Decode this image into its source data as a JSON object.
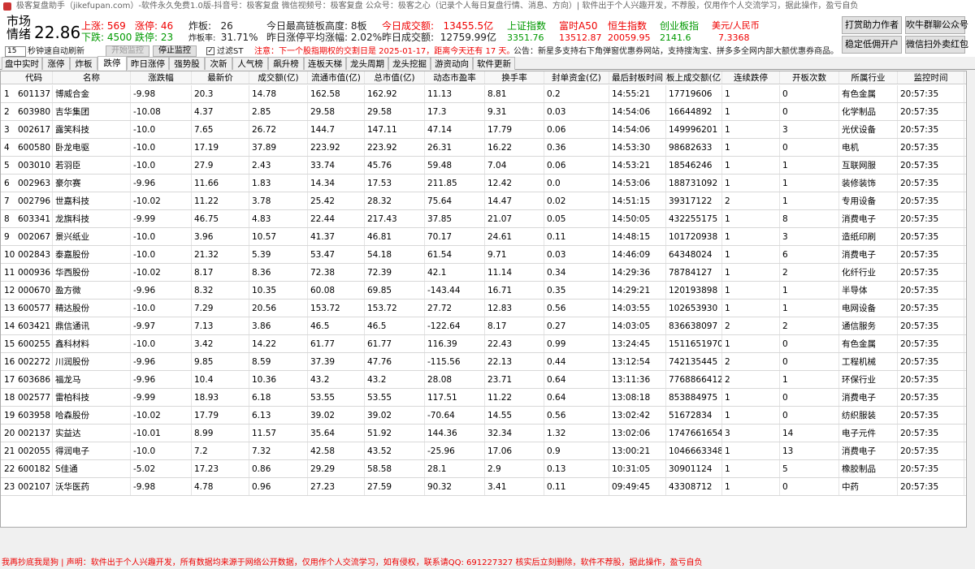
{
  "window": {
    "title": "极客复盘助手（jikefupan.com）-软件永久免费1.0版-抖音号：极客复盘  微信视频号：极客复盘  公众号：极客之心（记录个人每日复盘行情、消息、方向）| 软件出于个人兴趣开发，不荐股，仅用作个人交流学习，据此操作，盈亏自负"
  },
  "header": {
    "market_label": "市场\n情绪",
    "market_value": "22.86",
    "up_label": "上涨:",
    "up_value": "569",
    "limitup_label": "涨停:",
    "limitup_value": "46",
    "down_label": "下跌:",
    "down_value": "4500",
    "limitdown_label": "跌停:",
    "limitdown_value": "23",
    "zhaban_label": "炸板:",
    "zhaban_value": "26",
    "zhaban_rate_label": "炸板率:",
    "zhaban_rate_value": "31.71%",
    "max_height": "今日最高链板高度: 8板",
    "yest_avg": "昨日涨停平均涨幅: 2.02%",
    "today_vol_label": "今日成交额:",
    "today_vol_value": "13455.5亿",
    "yest_vol_label": "昨日成交额:",
    "yest_vol_value": "12759.99亿",
    "indices": [
      {
        "name": "上证指数",
        "value": "3351.76"
      },
      {
        "name": "富时A50",
        "value": "13512.87"
      },
      {
        "name": "恒生指数",
        "value": "20059.95"
      },
      {
        "name": "创业板指",
        "value": "2141.6"
      },
      {
        "name": "美元/人民币",
        "value": "7.3368"
      }
    ],
    "buttons": {
      "reward": "打赏助力作者",
      "cattle": "吹牛群聊公众号",
      "account": "稳定低佣开户",
      "wechat": "微信扫外卖红包"
    }
  },
  "toolbar": {
    "interval_value": "15",
    "interval_label": "秒钟速自动刷新",
    "start_btn": "开始监控",
    "stop_btn": "停止监控",
    "filter_st": "过滤ST",
    "notice": "注意：下一个股指期权的交割日是 2025-01-17，距离今天还有 17 天。",
    "announce": "公告：新星多支持右下角弹窗优惠券网站，支持搜淘宝、拼多多全网内部大额优惠券商品。"
  },
  "tabs": [
    "盘中实时",
    "涨停",
    "炸板",
    "跌停",
    "昨日涨停",
    "强势股",
    "次新",
    "人气榜",
    "飙升榜",
    "连板天梯",
    "龙头周期",
    "龙头挖掘",
    "游资动向",
    "软件更新"
  ],
  "active_tab": "跌停",
  "columns": [
    "代码",
    "名称",
    "涨跌幅",
    "最新价",
    "成交额(亿)",
    "流通市值(亿)",
    "总市值(亿)",
    "动态市盈率",
    "换手率",
    "封单资金(亿)",
    "最后封板时间",
    "板上成交额(亿)",
    "连续跌停",
    "开板次数",
    "所属行业",
    "监控时间"
  ],
  "rows": [
    [
      "601137",
      "博威合金",
      "-9.98",
      "20.3",
      "14.78",
      "162.58",
      "162.92",
      "11.13",
      "8.81",
      "0.2",
      "14:55:21",
      "17719606",
      "1",
      "0",
      "有色金属",
      "20:57:35"
    ],
    [
      "603980",
      "吉华集团",
      "-10.08",
      "4.37",
      "2.85",
      "29.58",
      "29.58",
      "17.3",
      "9.31",
      "0.03",
      "14:54:06",
      "16644892",
      "1",
      "0",
      "化学制品",
      "20:57:35"
    ],
    [
      "002617",
      "露笑科技",
      "-10.0",
      "7.65",
      "26.72",
      "144.7",
      "147.11",
      "47.14",
      "17.79",
      "0.06",
      "14:54:06",
      "149996201",
      "1",
      "3",
      "光伏设备",
      "20:57:35"
    ],
    [
      "600580",
      "卧龙电驱",
      "-10.0",
      "17.19",
      "37.89",
      "223.92",
      "223.92",
      "26.31",
      "16.22",
      "0.36",
      "14:53:30",
      "98682633",
      "1",
      "0",
      "电机",
      "20:57:35"
    ],
    [
      "003010",
      "若羽臣",
      "-10.0",
      "27.9",
      "2.43",
      "33.74",
      "45.76",
      "59.48",
      "7.04",
      "0.06",
      "14:53:21",
      "18546246",
      "1",
      "1",
      "互联网服",
      "20:57:35"
    ],
    [
      "002963",
      "豪尔赛",
      "-9.96",
      "11.66",
      "1.83",
      "14.34",
      "17.53",
      "211.85",
      "12.42",
      "0.0",
      "14:53:06",
      "188731092",
      "1",
      "1",
      "装修装饰",
      "20:57:35"
    ],
    [
      "002796",
      "世嘉科技",
      "-10.02",
      "11.22",
      "3.78",
      "25.42",
      "28.32",
      "75.64",
      "14.47",
      "0.02",
      "14:51:15",
      "39317122",
      "2",
      "1",
      "专用设备",
      "20:57:35"
    ],
    [
      "603341",
      "龙旗科技",
      "-9.99",
      "46.75",
      "4.83",
      "22.44",
      "217.43",
      "37.85",
      "21.07",
      "0.05",
      "14:50:05",
      "432255175",
      "1",
      "8",
      "消费电子",
      "20:57:35"
    ],
    [
      "002067",
      "景兴纸业",
      "-10.0",
      "3.96",
      "10.57",
      "41.37",
      "46.81",
      "70.17",
      "24.61",
      "0.11",
      "14:48:15",
      "101720938",
      "1",
      "3",
      "造纸印刷",
      "20:57:35"
    ],
    [
      "002843",
      "泰嘉股份",
      "-10.0",
      "21.32",
      "5.39",
      "53.47",
      "54.18",
      "61.54",
      "9.71",
      "0.03",
      "14:46:09",
      "64348024",
      "1",
      "6",
      "消费电子",
      "20:57:35"
    ],
    [
      "000936",
      "华西股份",
      "-10.02",
      "8.17",
      "8.36",
      "72.38",
      "72.39",
      "42.1",
      "11.14",
      "0.34",
      "14:29:36",
      "78784127",
      "1",
      "2",
      "化纤行业",
      "20:57:35"
    ],
    [
      "000670",
      "盈方微",
      "-9.96",
      "8.32",
      "10.35",
      "60.08",
      "69.85",
      "-143.44",
      "16.71",
      "0.35",
      "14:29:21",
      "120193898",
      "1",
      "1",
      "半导体",
      "20:57:35"
    ],
    [
      "600577",
      "精达股份",
      "-10.0",
      "7.29",
      "20.56",
      "153.72",
      "153.72",
      "27.72",
      "12.83",
      "0.56",
      "14:03:55",
      "102653930",
      "1",
      "1",
      "电网设备",
      "20:57:35"
    ],
    [
      "603421",
      "鼎信通讯",
      "-9.97",
      "7.13",
      "3.86",
      "46.5",
      "46.5",
      "-122.64",
      "8.17",
      "0.27",
      "14:03:05",
      "836638097",
      "2",
      "2",
      "通信服务",
      "20:57:35"
    ],
    [
      "600255",
      "鑫科材料",
      "-10.0",
      "3.42",
      "14.22",
      "61.77",
      "61.77",
      "116.39",
      "22.43",
      "0.99",
      "13:24:45",
      "1511651970",
      "1",
      "0",
      "有色金属",
      "20:57:35"
    ],
    [
      "002272",
      "川润股份",
      "-9.96",
      "9.85",
      "8.59",
      "37.39",
      "47.76",
      "-115.56",
      "22.13",
      "0.44",
      "13:12:54",
      "742135445",
      "2",
      "0",
      "工程机械",
      "20:57:35"
    ],
    [
      "603686",
      "福龙马",
      "-9.96",
      "10.4",
      "10.36",
      "43.2",
      "43.2",
      "28.08",
      "23.71",
      "0.64",
      "13:11:36",
      "7768866412",
      "2",
      "1",
      "环保行业",
      "20:57:35"
    ],
    [
      "002577",
      "雷柏科技",
      "-9.99",
      "18.93",
      "6.18",
      "53.55",
      "53.55",
      "117.51",
      "11.22",
      "0.64",
      "13:08:18",
      "853884975",
      "1",
      "0",
      "消费电子",
      "20:57:35"
    ],
    [
      "603958",
      "哈森股份",
      "-10.02",
      "17.79",
      "6.13",
      "39.02",
      "39.02",
      "-70.64",
      "14.55",
      "0.56",
      "13:02:42",
      "51672834",
      "1",
      "0",
      "纺织服装",
      "20:57:35"
    ],
    [
      "002137",
      "实益达",
      "-10.01",
      "8.99",
      "11.57",
      "35.64",
      "51.92",
      "144.36",
      "32.34",
      "1.32",
      "13:02:06",
      "1747661654",
      "3",
      "14",
      "电子元件",
      "20:57:35"
    ],
    [
      "002055",
      "得润电子",
      "-10.0",
      "7.2",
      "7.32",
      "42.58",
      "43.52",
      "-25.96",
      "17.06",
      "0.9",
      "13:00:21",
      "1046663348",
      "1",
      "13",
      "消费电子",
      "20:57:35"
    ],
    [
      "600182",
      "S佳通",
      "-5.02",
      "17.23",
      "0.86",
      "29.29",
      "58.58",
      "28.1",
      "2.9",
      "0.13",
      "10:31:05",
      "30901124",
      "1",
      "5",
      "橡胶制品",
      "20:57:35"
    ],
    [
      "002107",
      "沃华医药",
      "-9.98",
      "4.78",
      "0.96",
      "27.23",
      "27.59",
      "90.32",
      "3.41",
      "0.11",
      "09:49:45",
      "43308712",
      "1",
      "0",
      "中药",
      "20:57:35"
    ]
  ],
  "footer": "我再抄底我是狗 | 声明：软件出于个人兴趣开发，所有数据均来源于网络公开数据，仅用作个人交流学习，如有侵权，联系请QQ: 691227327  核实后立刻删除，软件不荐股，据此操作，盈亏自负"
}
